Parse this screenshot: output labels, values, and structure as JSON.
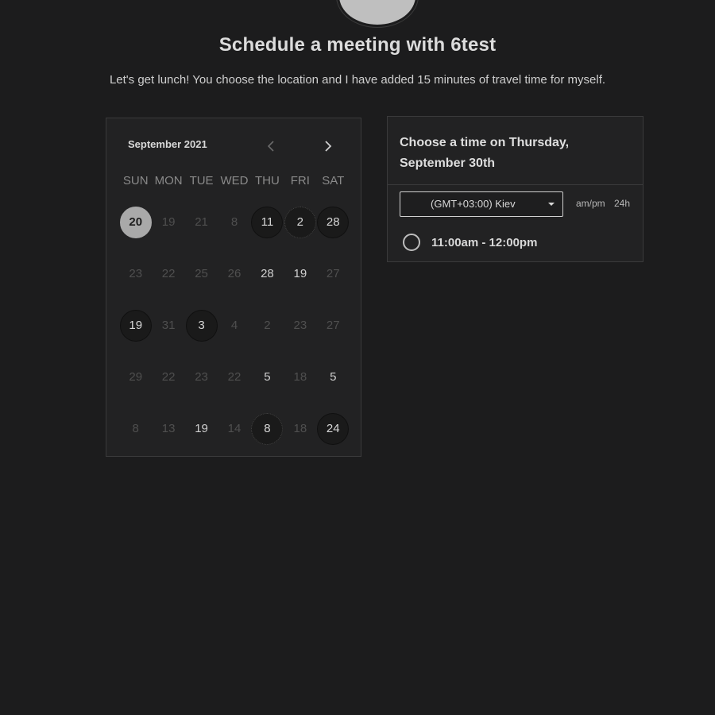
{
  "header": {
    "title": "Schedule a meeting with 6test",
    "subtitle": "Let's get lunch! You choose the location and I have added 15 minutes of travel time for myself."
  },
  "calendar": {
    "month_label": "September 2021",
    "weekdays": [
      "SUN",
      "MON",
      "TUE",
      "WED",
      "THU",
      "FRI",
      "SAT"
    ],
    "rows": [
      [
        {
          "n": "20",
          "s": "selected"
        },
        {
          "n": "19",
          "s": "muted"
        },
        {
          "n": "21",
          "s": "muted"
        },
        {
          "n": "8",
          "s": "muted"
        },
        {
          "n": "11",
          "s": "ringed"
        },
        {
          "n": "2",
          "s": "ringed dotted"
        },
        {
          "n": "28",
          "s": "ringed"
        }
      ],
      [
        {
          "n": "23",
          "s": "muted"
        },
        {
          "n": "22",
          "s": "muted"
        },
        {
          "n": "25",
          "s": "muted"
        },
        {
          "n": "26",
          "s": "muted"
        },
        {
          "n": "28",
          "s": "bright"
        },
        {
          "n": "19",
          "s": "bright"
        },
        {
          "n": "27",
          "s": "muted"
        }
      ],
      [
        {
          "n": "19",
          "s": "ringed"
        },
        {
          "n": "31",
          "s": "muted"
        },
        {
          "n": "3",
          "s": "ringed"
        },
        {
          "n": "4",
          "s": "muted"
        },
        {
          "n": "2",
          "s": "muted"
        },
        {
          "n": "23",
          "s": "muted"
        },
        {
          "n": "27",
          "s": "muted"
        }
      ],
      [
        {
          "n": "29",
          "s": "muted"
        },
        {
          "n": "22",
          "s": "muted"
        },
        {
          "n": "23",
          "s": "muted"
        },
        {
          "n": "22",
          "s": "muted"
        },
        {
          "n": "5",
          "s": "bright"
        },
        {
          "n": "18",
          "s": "muted"
        },
        {
          "n": "5",
          "s": "bright"
        }
      ],
      [
        {
          "n": "8",
          "s": "muted"
        },
        {
          "n": "13",
          "s": "muted"
        },
        {
          "n": "19",
          "s": "bright"
        },
        {
          "n": "14",
          "s": "muted"
        },
        {
          "n": "8",
          "s": "ringed dotted"
        },
        {
          "n": "18",
          "s": "muted"
        },
        {
          "n": "24",
          "s": "ringed"
        }
      ]
    ]
  },
  "time_panel": {
    "heading": "Choose a time on Thursday, September 30th",
    "timezone": "(GMT+03:00) Kiev",
    "format_ampm": "am/pm",
    "format_24h": "24h",
    "slots": [
      {
        "label": "11:00am - 12:00pm"
      }
    ]
  },
  "colors": {
    "background": "#1c1c1d",
    "card": "#222223",
    "selected_day": "#a9a9a9"
  }
}
